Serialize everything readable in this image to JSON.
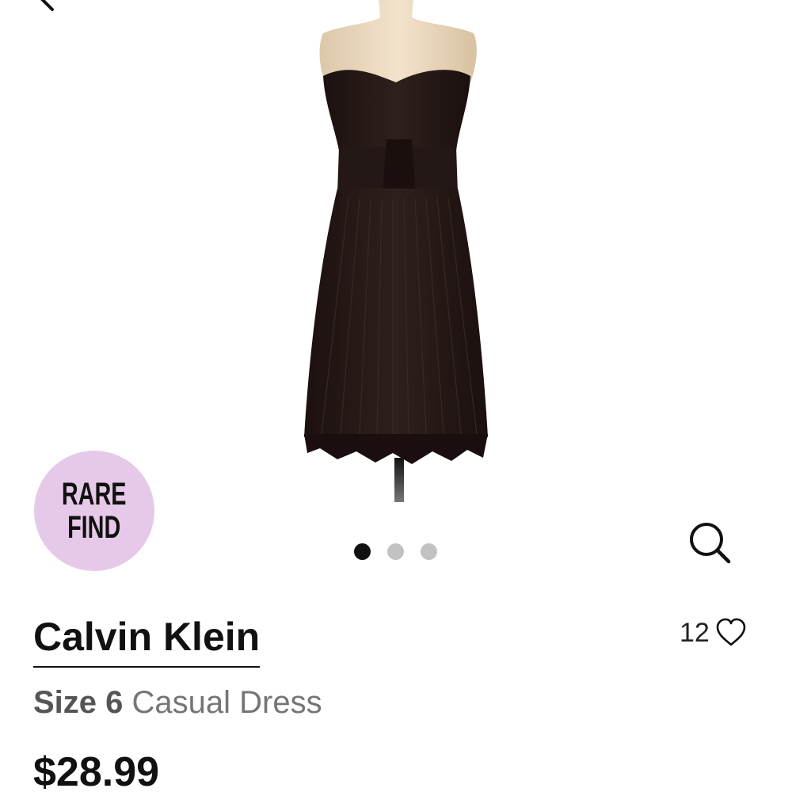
{
  "navigation": {
    "back_icon": "chevron-left-icon"
  },
  "product": {
    "image_alt": "black strapless pleated dress on mannequin",
    "badge_line1": "RARE",
    "badge_line2": "FIND",
    "badge_color": "#e6c9e8",
    "carousel": {
      "total_images": 3,
      "active_index": 0
    },
    "search_icon": "search-icon",
    "brand": "Calvin Klein",
    "favorite_count": "12",
    "favorite_icon": "heart-outline-icon",
    "size_label": "Size 6",
    "category": "Casual Dress",
    "price": "$28.99"
  }
}
